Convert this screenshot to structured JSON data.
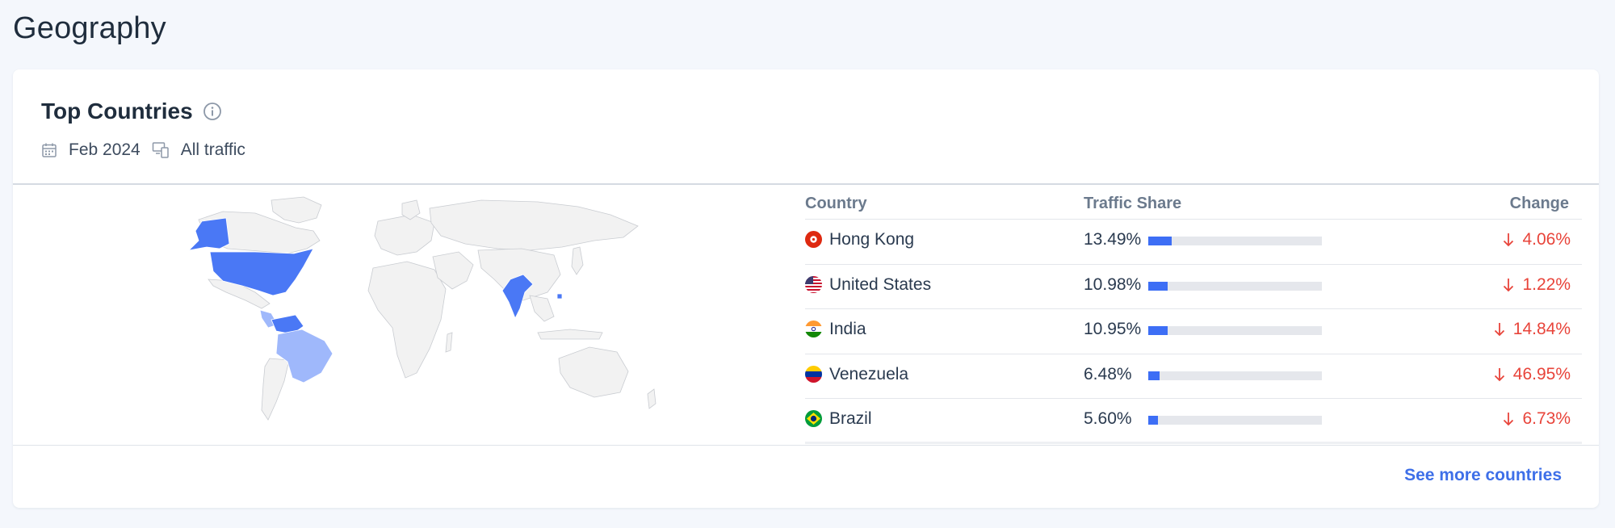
{
  "page": {
    "title": "Geography"
  },
  "card": {
    "title": "Top Countries",
    "period": "Feb 2024",
    "traffic_filter": "All traffic",
    "see_more_label": "See more countries"
  },
  "table": {
    "headers": {
      "country": "Country",
      "traffic_share": "Traffic Share",
      "change": "Change"
    },
    "rows": [
      {
        "country": "Hong Kong",
        "share": "13.49%",
        "share_value": 13.49,
        "change": "4.06%",
        "direction": "down"
      },
      {
        "country": "United States",
        "share": "10.98%",
        "share_value": 10.98,
        "change": "1.22%",
        "direction": "down"
      },
      {
        "country": "India",
        "share": "10.95%",
        "share_value": 10.95,
        "change": "14.84%",
        "direction": "down"
      },
      {
        "country": "Venezuela",
        "share": "6.48%",
        "share_value": 6.48,
        "change": "46.95%",
        "direction": "down"
      },
      {
        "country": "Brazil",
        "share": "5.60%",
        "share_value": 5.6,
        "change": "6.73%",
        "direction": "down"
      }
    ]
  },
  "colors": {
    "accent": "#3d6ef5",
    "link": "#3e6fe8",
    "negative": "#e8443a",
    "map_highlight": "#4a78f5",
    "map_highlight_light": "#9fb8fb",
    "map_base": "#f2f2f2"
  },
  "icons": {
    "info": "info-icon",
    "calendar": "calendar-icon",
    "devices": "devices-icon",
    "change_arrow": "arrow-down-icon"
  }
}
